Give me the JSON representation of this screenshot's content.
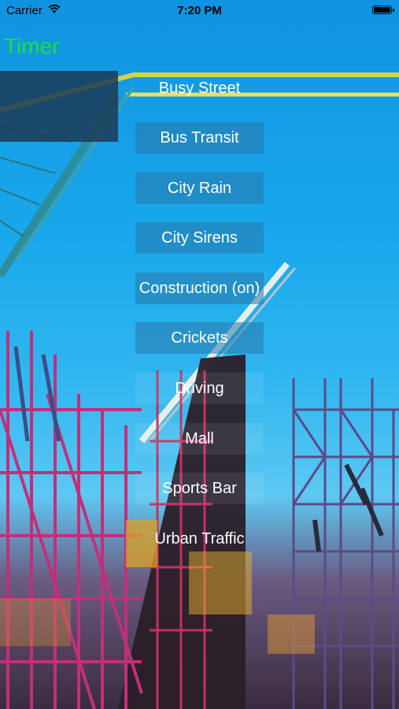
{
  "status_bar": {
    "carrier": "Carrier",
    "time": "7:20 PM",
    "wifi_icon": "wifi-icon",
    "battery_icon": "battery-icon"
  },
  "header": {
    "title": "Timer",
    "title_color": "#1ee12e"
  },
  "sounds": [
    {
      "label": "Busy Street"
    },
    {
      "label": "Bus Transit"
    },
    {
      "label": "City Rain"
    },
    {
      "label": "City Sirens"
    },
    {
      "label": "Construction (on)"
    },
    {
      "label": "Crickets"
    },
    {
      "label": "Driving"
    },
    {
      "label": "Mall"
    },
    {
      "label": "Sports Bar"
    },
    {
      "label": "Urban Traffic"
    }
  ]
}
